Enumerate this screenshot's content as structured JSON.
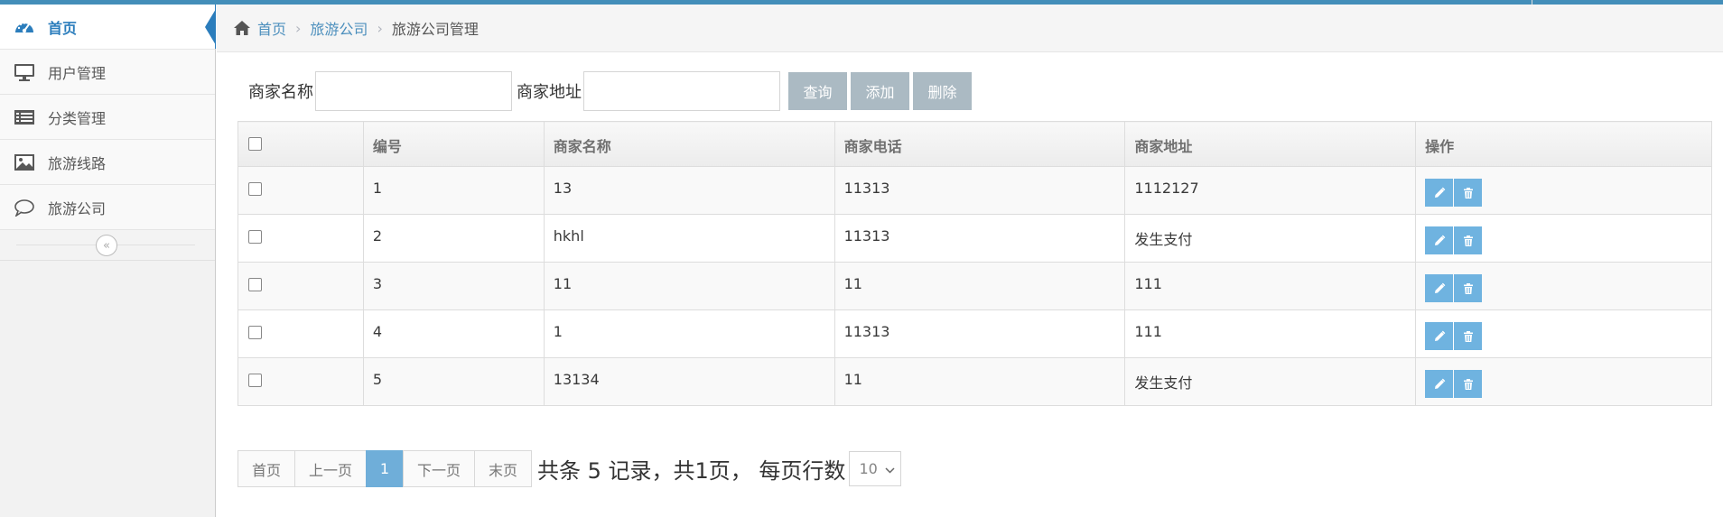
{
  "sidebar": {
    "items": [
      {
        "label": "首页",
        "icon": "dashboard-icon",
        "active": true
      },
      {
        "label": "用户管理",
        "icon": "desktop-icon"
      },
      {
        "label": "分类管理",
        "icon": "list-icon"
      },
      {
        "label": "旅游线路",
        "icon": "picture-icon"
      },
      {
        "label": "旅游公司",
        "icon": "comment-icon"
      }
    ],
    "collapse_icon": "«"
  },
  "breadcrumb": {
    "home": "首页",
    "parent": "旅游公司",
    "current": "旅游公司管理",
    "separator": "›"
  },
  "search": {
    "name_label": "商家名称",
    "name_value": "",
    "address_label": "商家地址",
    "address_value": "",
    "query_button": "查询",
    "add_button": "添加",
    "delete_button": "删除"
  },
  "table": {
    "columns": [
      "编号",
      "商家名称",
      "商家电话",
      "商家地址",
      "操作"
    ],
    "rows": [
      {
        "id": "1",
        "name": "13",
        "phone": "11313",
        "address": "1112127"
      },
      {
        "id": "2",
        "name": "hkhl",
        "phone": "11313",
        "address": "发生支付"
      },
      {
        "id": "3",
        "name": "11",
        "phone": "11",
        "address": "111"
      },
      {
        "id": "4",
        "name": "1",
        "phone": "11313",
        "address": "111"
      },
      {
        "id": "5",
        "name": "13134",
        "phone": "11",
        "address": "发生支付"
      }
    ]
  },
  "pagination": {
    "first": "首页",
    "prev": "上一页",
    "current_page": "1",
    "next": "下一页",
    "last": "末页",
    "info": "共条 5 记录，共1页， 每页行数",
    "page_size": "10"
  },
  "colors": {
    "accent": "#438eb9",
    "link": "#4c8fbd",
    "button_gray": "#abbac3",
    "op_button": "#6fb3e0",
    "active_page": "#6faed9"
  }
}
